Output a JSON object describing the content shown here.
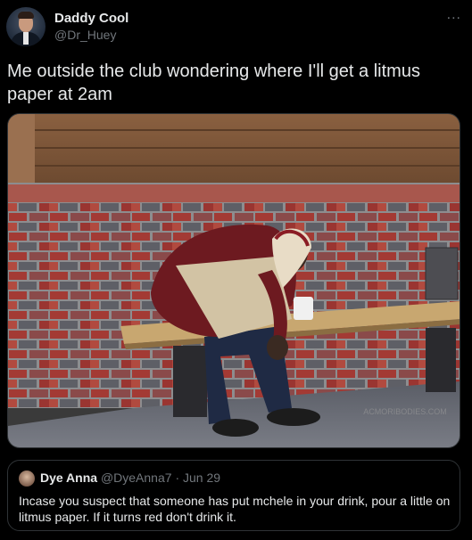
{
  "author": {
    "display_name": "Daddy Cool",
    "handle": "@Dr_Huey",
    "avatar_icon": "profile-photo-man-in-suit"
  },
  "more_icon": "...",
  "tweet_text": "Me outside the club wondering where I'll get a litmus paper at 2am",
  "media": {
    "watermark": "ACMORIBODIES.COM"
  },
  "quote": {
    "display_name": "Dye Anna",
    "handle": "@DyeAnna7",
    "separator": "·",
    "date": "Jun 29",
    "text": "Incase you suspect that someone has put mchele in your drink, pour a little on litmus paper. If it turns red don't drink it."
  }
}
